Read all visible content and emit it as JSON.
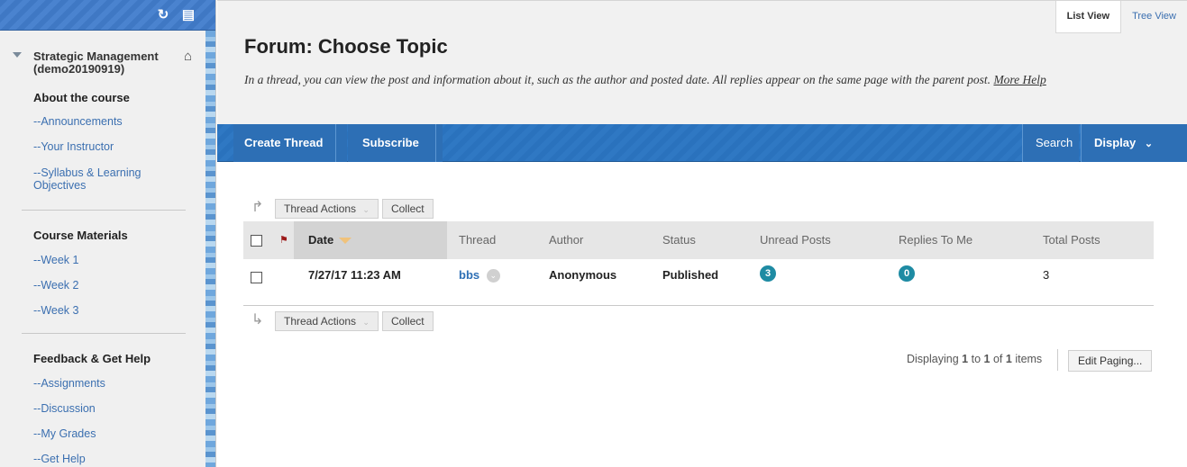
{
  "sidebar": {
    "course_title": "Strategic Management (demo20190919)",
    "sections": [
      {
        "heading": "About the course",
        "links": [
          "--Announcements",
          "--Your Instructor",
          "--Syllabus & Learning Objectives"
        ]
      },
      {
        "heading": "Course Materials",
        "links": [
          "--Week 1",
          "--Week 2",
          "--Week 3"
        ]
      },
      {
        "heading": "Feedback & Get Help",
        "links": [
          "--Assignments",
          "--Discussion",
          "--My Grades",
          "--Get Help"
        ]
      }
    ]
  },
  "view_tabs": {
    "list": "List View",
    "tree": "Tree View",
    "active": "List View"
  },
  "page": {
    "title": "Forum: Choose Topic",
    "description": "In a thread, you can view the post and information about it, such as the author and posted date. All replies appear on the same page with the parent post.",
    "more_help": "More Help"
  },
  "action_bar": {
    "create": "Create Thread",
    "subscribe": "Subscribe",
    "search": "Search",
    "display": "Display"
  },
  "toolbar": {
    "thread_actions": "Thread Actions",
    "collect": "Collect"
  },
  "table": {
    "columns": [
      "Date",
      "Thread",
      "Author",
      "Status",
      "Unread Posts",
      "Replies To Me",
      "Total Posts"
    ],
    "rows": [
      {
        "date": "7/27/17 11:23 AM",
        "thread": "bbs",
        "author": "Anonymous",
        "status": "Published",
        "unread": "3",
        "replies": "0",
        "total": "3"
      }
    ]
  },
  "paging": {
    "displaying": "Displaying",
    "from": "1",
    "to_word": "to",
    "to": "1",
    "of_word": "of",
    "total": "1",
    "items": "items",
    "edit": "Edit Paging..."
  },
  "colors": {
    "accent": "#2d6fb5",
    "badge": "#1e8ba3",
    "sort_caret": "#f0c27b"
  }
}
